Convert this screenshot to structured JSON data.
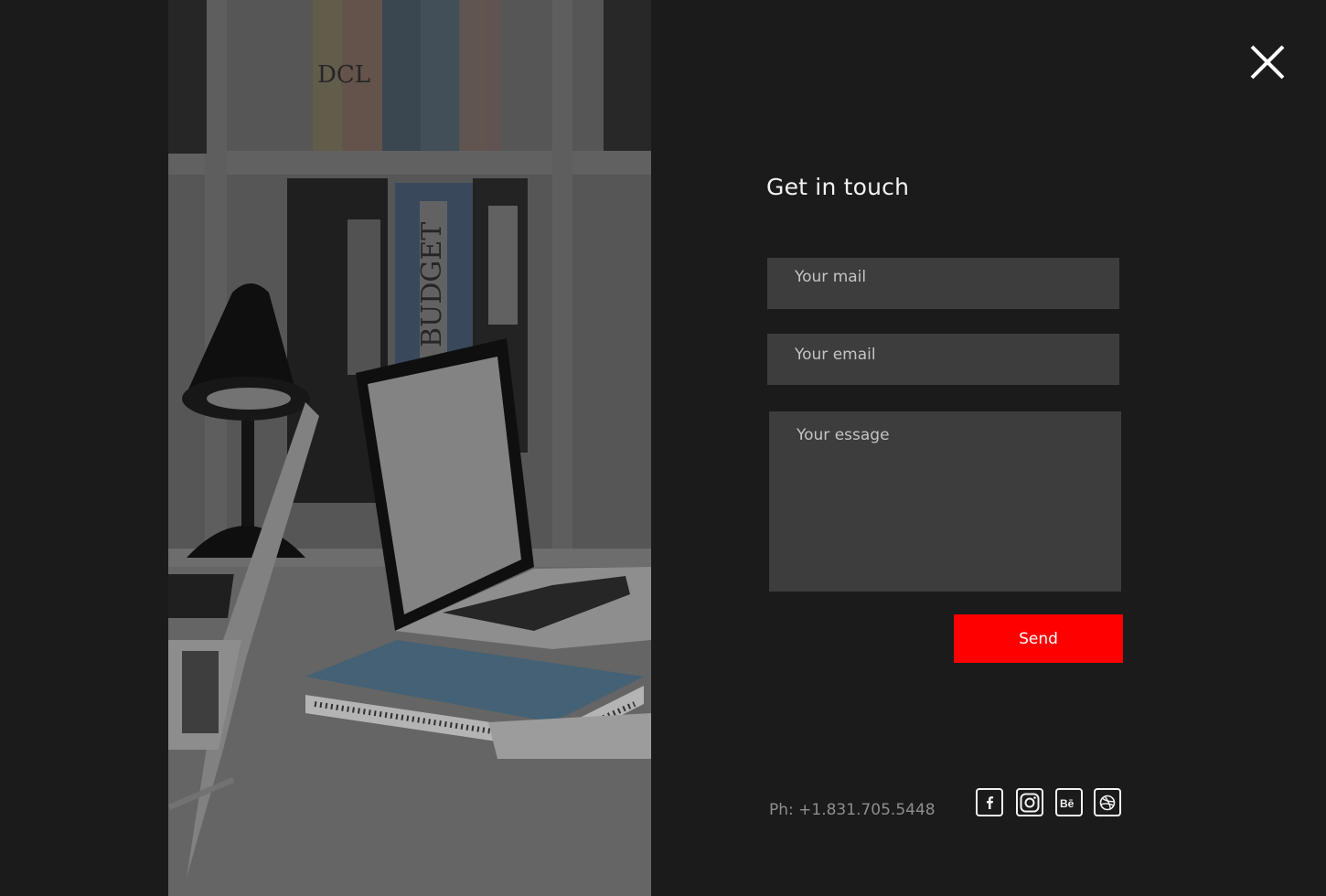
{
  "contact": {
    "title": "Get in touch",
    "mail_placeholder": "Your mail",
    "email_placeholder": "Your email",
    "message_placeholder": "Your essage",
    "send_label": "Send",
    "phone": "Ph: +1.831.705.5448"
  },
  "photo": {
    "binder_label": "BUDGET",
    "book_spine_label": "DCL"
  },
  "social": [
    {
      "name": "facebook-icon",
      "glyph": "f"
    },
    {
      "name": "instagram-icon",
      "glyph": ""
    },
    {
      "name": "behance-icon",
      "glyph": "Bē"
    },
    {
      "name": "dribbble-icon",
      "glyph": ""
    }
  ],
  "colors": {
    "background": "#1b1b1b",
    "field": "#3d3d3d",
    "accent": "#ff0000",
    "text": "#f2f2f2",
    "muted": "#8e8e8e"
  }
}
